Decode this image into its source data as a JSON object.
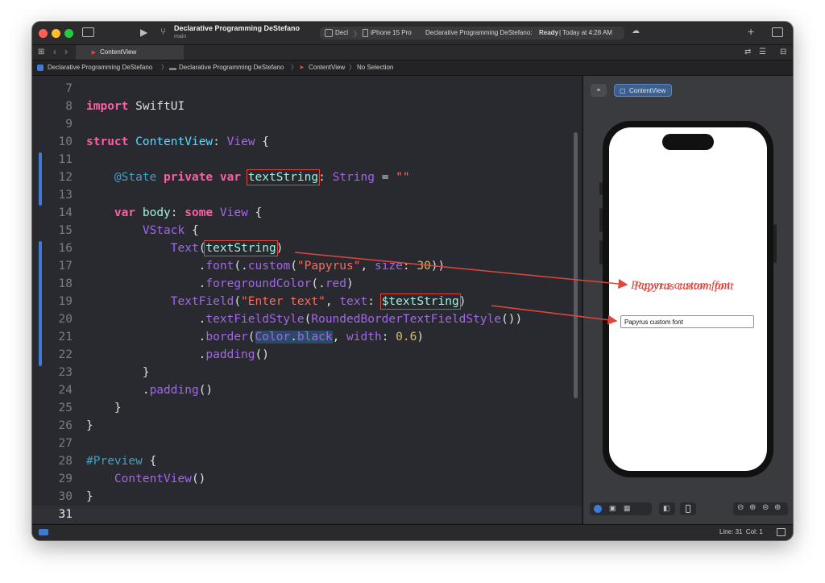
{
  "titlebar": {
    "project": "Declarative Programming DeStefano",
    "branch": "main",
    "scheme_short": "Decl",
    "device": "iPhone 15 Pro",
    "status_project": "Declarative Programming DeStefano:",
    "status_state": "Ready",
    "status_time": "| Today at 4:28 AM"
  },
  "tabs": [
    {
      "label": "ContentView"
    }
  ],
  "breadcrumb": {
    "items": [
      "Declarative Programming DeStefano",
      "Declarative Programming DeStefano",
      "ContentView",
      "No Selection"
    ]
  },
  "editor": {
    "line_numbers": [
      "7",
      "8",
      "9",
      "10",
      "11",
      "12",
      "13",
      "14",
      "15",
      "16",
      "17",
      "18",
      "19",
      "20",
      "21",
      "22",
      "23",
      "24",
      "25",
      "26",
      "27",
      "28",
      "29",
      "30",
      "31"
    ],
    "current_line": "31"
  },
  "preview": {
    "tab_label": "ContentView",
    "text_output": "Papyrus custom font",
    "textfield_value": "Papyrus custom font"
  },
  "annotation": {
    "label": "Papyrus custom font",
    "color": "#e0463b"
  },
  "statusbar": {
    "position": "Line: 31  Col: 1"
  },
  "colors": {
    "keyword": "#fc5fa3",
    "type": "#5dd8ff",
    "string": "#fc6a5d",
    "number": "#d0bf69",
    "accent": "#3d7bd6"
  }
}
